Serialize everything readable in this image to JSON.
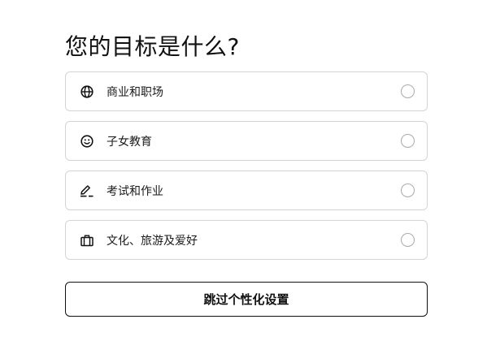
{
  "page": {
    "title": "您的目标是什么?"
  },
  "options": [
    {
      "label": "商业和职场",
      "icon": "globe-icon",
      "selected": false
    },
    {
      "label": "子女教育",
      "icon": "smiley-icon",
      "selected": false
    },
    {
      "label": "考试和作业",
      "icon": "pencil-icon",
      "selected": false
    },
    {
      "label": "文化、旅游及爱好",
      "icon": "suitcase-icon",
      "selected": false
    }
  ],
  "actions": {
    "skip_label": "跳过个性化设置"
  },
  "colors": {
    "border": "#d4d4d8",
    "radio_border": "#a9a9b0",
    "text": "#111111",
    "background": "#ffffff"
  }
}
